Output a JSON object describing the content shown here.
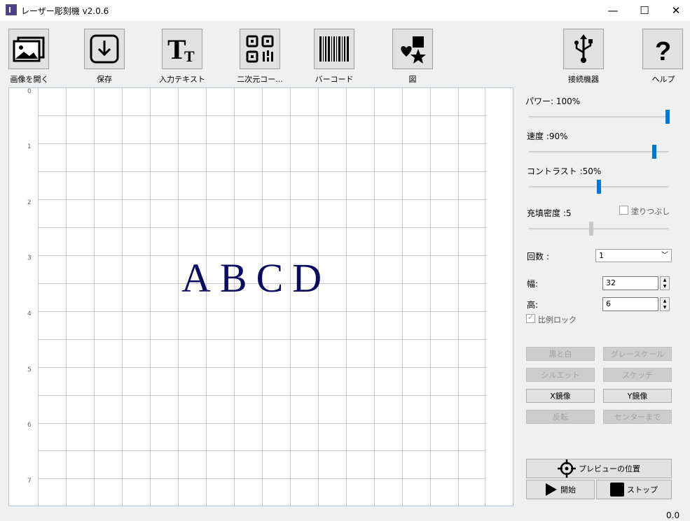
{
  "window": {
    "title": "レーザー彫刻機 v2.0.6"
  },
  "toolbar": {
    "open_image": "画像を開く",
    "save": "保存",
    "input_text": "入力テキスト",
    "qrcode": "二次元コー...",
    "barcode": "バーコード",
    "shape": "図",
    "device": "接続機器",
    "help": "ヘルプ"
  },
  "canvas": {
    "ruler": [
      "0",
      "1",
      "2",
      "3",
      "4",
      "5",
      "6",
      "7"
    ],
    "text": "ABCD",
    "text_color": "#0b0b60"
  },
  "panel": {
    "power": {
      "label": "パワー: 100%",
      "value": 100
    },
    "speed": {
      "label": "速度 :90%",
      "value": 90
    },
    "contrast": {
      "label": "コントラスト :50%",
      "value": 50
    },
    "fill_density": {
      "label": "充填密度 :5",
      "value": 5
    },
    "fill_check": "塗りつぶし",
    "count_label": "回数 :",
    "count_value": "1",
    "width_label": "幅:",
    "width_value": "32",
    "height_label": "高:",
    "height_value": "6",
    "ratio_lock": "比例ロック",
    "buttons": {
      "bw": "黒と白",
      "gray": "グレースケール",
      "silhouette": "シルエット",
      "sketch": "スケッチ",
      "x_mirror": "X鏡像",
      "y_mirror": "Y鏡像",
      "invert": "反転",
      "center": "センターまで",
      "preview": "プレビューの位置",
      "start": "開始",
      "stop": "ストップ"
    }
  },
  "status": "0.0",
  "accent_color": "#0078d7"
}
